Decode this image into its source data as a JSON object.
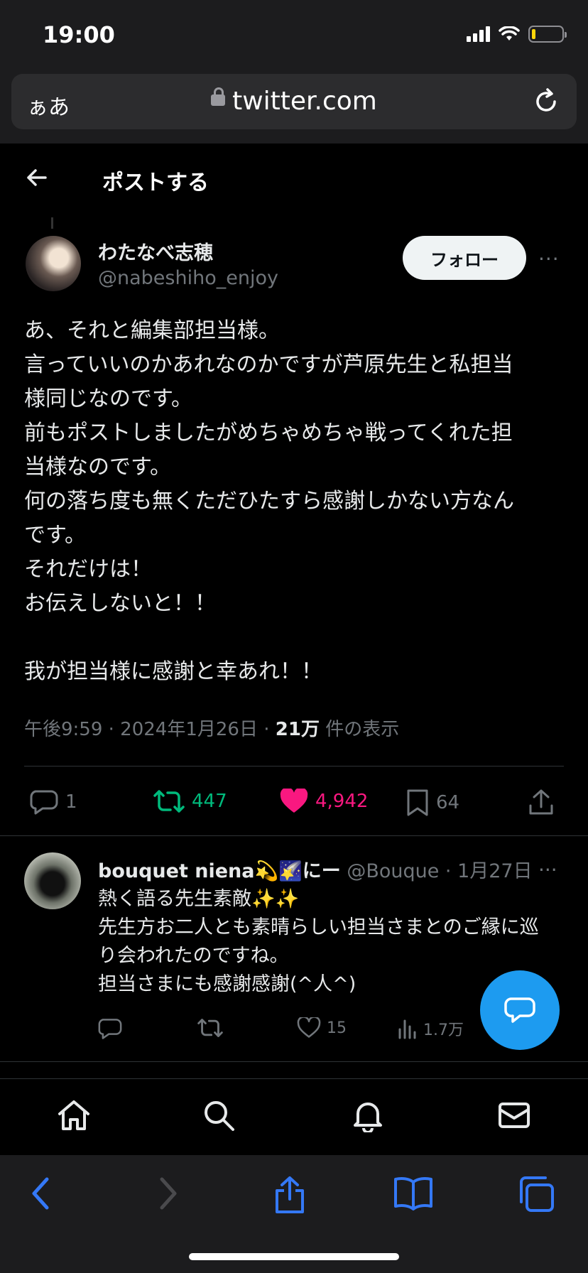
{
  "status_bar": {
    "time": "19:00"
  },
  "browser": {
    "text_size_button": "ぁあ",
    "url": "twitter.com"
  },
  "header": {
    "title": "ポストする"
  },
  "tweet": {
    "author_name": "わたなべ志穂",
    "author_handle": "@nabeshiho_enjoy",
    "follow_label": "フォロー",
    "more": "···",
    "lines": [
      "あ、それと編集部担当様。",
      "言っていいのかあれなのかですが芦原先生と私担当",
      "様同じなのです。",
      "前もポストしましたがめちゃめちゃ戦ってくれた担",
      "当様なのです。",
      "何の落ち度も無くただひたすら感謝しかない方なん",
      "です。",
      "それだけは！",
      "お伝えしないと！！",
      "",
      "我が担当様に感謝と幸あれ！！"
    ],
    "meta_time": "午後9:59 · 2024年1月26日 · ",
    "meta_views": "21万",
    "meta_views_label": " 件の表示",
    "counts": {
      "replies": "1",
      "reposts": "447",
      "likes": "4,942",
      "bookmarks": "64"
    }
  },
  "reply": {
    "name": "bouquet niena💫🌠にー",
    "handle": " @Bouque · 1月27日",
    "more": "···",
    "lines": [
      "熱く語る先生素敵✨✨",
      "先生方お二人とも素晴らしい担当さまとのご縁に巡",
      "り会われたのですね。",
      "担当さまにも感謝感謝(^人^)"
    ],
    "counts": {
      "likes": "15",
      "views": "1.7万"
    }
  },
  "colors": {
    "background": "#000000",
    "accent": "#1d9bf0",
    "repost_green": "#00ba7c",
    "like_pink": "#f91880",
    "muted": "#71767b",
    "safari_blue": "#3478f6"
  },
  "icons": [
    "back-arrow-icon",
    "lock-icon",
    "reload-icon",
    "reply-icon",
    "repost-icon",
    "heart-icon",
    "bookmark-icon",
    "share-icon",
    "views-icon",
    "compose-icon",
    "home-icon",
    "search-icon",
    "bell-icon",
    "mail-icon",
    "safari-back-icon",
    "safari-forward-icon",
    "safari-share-icon",
    "safari-bookmarks-icon",
    "safari-tabs-icon"
  ]
}
